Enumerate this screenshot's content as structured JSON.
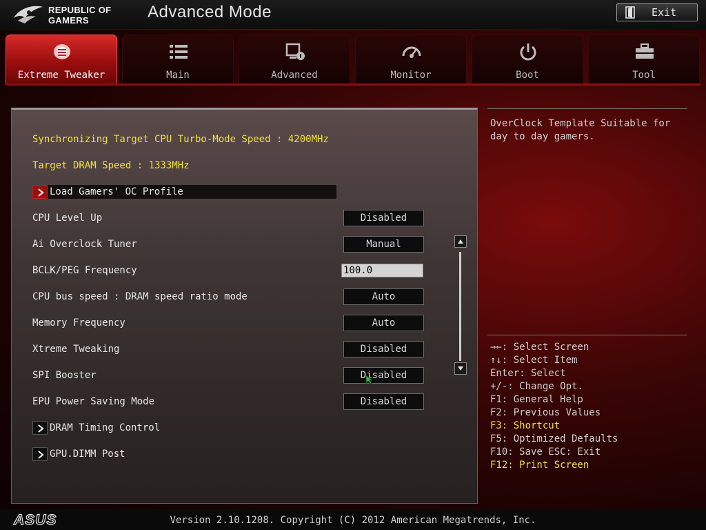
{
  "header": {
    "logo_line1": "REPUBLIC OF",
    "logo_line2": "GAMERS",
    "title": "Advanced Mode",
    "exit_label": "Exit"
  },
  "tabs": [
    {
      "label": "Extreme Tweaker",
      "icon": "extreme-tweaker-icon",
      "active": true
    },
    {
      "label": "Main",
      "icon": "list-icon",
      "active": false
    },
    {
      "label": "Advanced",
      "icon": "advanced-settings-icon",
      "active": false
    },
    {
      "label": "Monitor",
      "icon": "gauge-icon",
      "active": false
    },
    {
      "label": "Boot",
      "icon": "power-icon",
      "active": false
    },
    {
      "label": "Tool",
      "icon": "toolbox-icon",
      "active": false
    }
  ],
  "main": {
    "info1": "Synchronizing Target CPU Turbo-Mode Speed : 4200MHz",
    "info2": "Target DRAM Speed : 1333MHz",
    "load_profile": "Load Gamers' OC Profile",
    "settings": [
      {
        "label": "CPU Level Up",
        "value": "Disabled"
      },
      {
        "label": "Ai Overclock Tuner",
        "value": "Manual"
      },
      {
        "label": "BCLK/PEG Frequency",
        "value": "100.0"
      },
      {
        "label": "CPU bus speed : DRAM speed ratio mode",
        "value": "Auto"
      },
      {
        "label": "Memory Frequency",
        "value": "Auto"
      },
      {
        "label": "Xtreme Tweaking",
        "value": "Disabled"
      },
      {
        "label": "SPI Booster",
        "value": "Disabled"
      },
      {
        "label": "EPU Power Saving Mode",
        "value": "Disabled"
      }
    ],
    "submenu1": "DRAM Timing Control",
    "submenu2": "GPU.DIMM Post"
  },
  "help": {
    "description": "OverClock Template Suitable for day to day gamers.",
    "keys": [
      {
        "text": "→←: Select Screen",
        "highlight": false
      },
      {
        "text": "↑↓: Select Item",
        "highlight": false
      },
      {
        "text": "Enter: Select",
        "highlight": false
      },
      {
        "text": "+/-: Change Opt.",
        "highlight": false
      },
      {
        "text": "F1: General Help",
        "highlight": false
      },
      {
        "text": "F2: Previous Values",
        "highlight": false
      },
      {
        "text": "F3: Shortcut",
        "highlight": true
      },
      {
        "text": "F5: Optimized Defaults",
        "highlight": false
      },
      {
        "text": "F10: Save  ESC: Exit",
        "highlight": false
      },
      {
        "text": "F12: Print Screen",
        "highlight": true
      }
    ]
  },
  "footer": {
    "brand": "ASUS",
    "version": "Version 2.10.1208. Copyright (C) 2012 American Megatrends, Inc."
  },
  "colors": {
    "accent": "#c01818",
    "highlight_text": "#f0e040"
  }
}
